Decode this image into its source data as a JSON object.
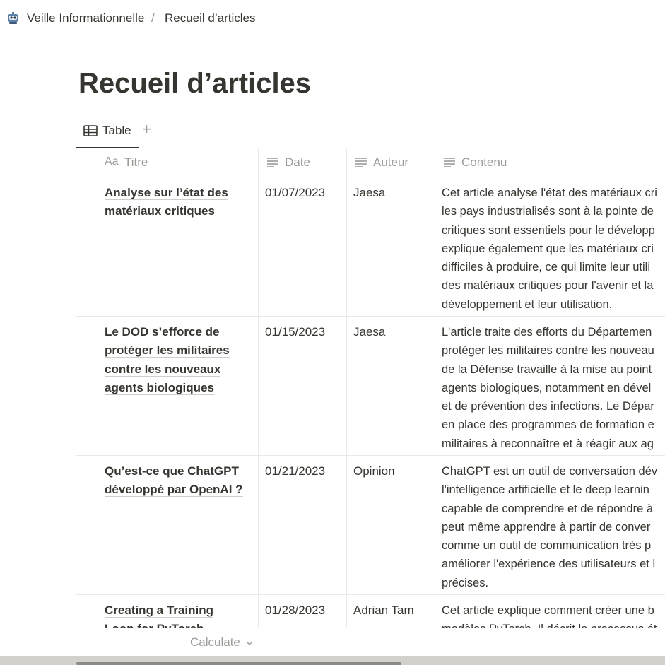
{
  "breadcrumb": {
    "workspace": "Veille Informationnelle",
    "separator": "/",
    "page": "Recueil d’articles"
  },
  "page": {
    "title": "Recueil d’articles"
  },
  "views": {
    "active_label": "Table",
    "add_icon": "+"
  },
  "columns": {
    "title": "Titre",
    "title_icon_text": "Aa",
    "date": "Date",
    "author": "Auteur",
    "content": "Contenu"
  },
  "rows": [
    {
      "title": "Analyse sur l’état des matériaux critiques",
      "date": "01/07/2023",
      "author": "Jaesa",
      "content": "Cet article analyse l'état des matériaux cri\nles pays industrialisés sont à la pointe de\ncritiques sont essentiels pour le développ\nexplique également que les matériaux cri\ndifficiles à produire, ce qui limite leur utili\ndes matériaux critiques pour l'avenir et la\ndéveloppement et leur utilisation."
    },
    {
      "title": "Le DOD s’efforce de protéger les militaires contre les nouveaux agents biologiques",
      "date": "01/15/2023",
      "author": "Jaesa",
      "content": "L'article traite des efforts du Départemen\nprotéger les militaires contre les nouveau\nde la Défense travaille à la mise au point\nagents biologiques, notamment en dével\net de prévention des infections. Le Dépar\nen place des programmes de formation e\nmilitaires à reconnaître et à réagir aux ag"
    },
    {
      "title": "Qu’est-ce que ChatGPT développé par OpenAI ?",
      "date": "01/21/2023",
      "author": "Opinion",
      "content": "ChatGPT est un outil de conversation dév\nl'intelligence artificielle et le deep learnin\ncapable de comprendre et de répondre à\npeut même apprendre à partir de conver\ncomme un outil de communication très p\naméliorer l'expérience des utilisateurs et l\nprécises."
    },
    {
      "title": "Creating a Training Loop for PyTorch Models",
      "date": "01/28/2023",
      "author": "Adrian Tam",
      "content": "Cet article explique comment créer une b\nmodèles PyTorch. Il décrit le processus ét"
    }
  ],
  "footer": {
    "calculate_label": "Calculate"
  },
  "colors": {
    "text": "#37352f",
    "muted": "#9b9a97",
    "border": "#e9e9e7"
  }
}
